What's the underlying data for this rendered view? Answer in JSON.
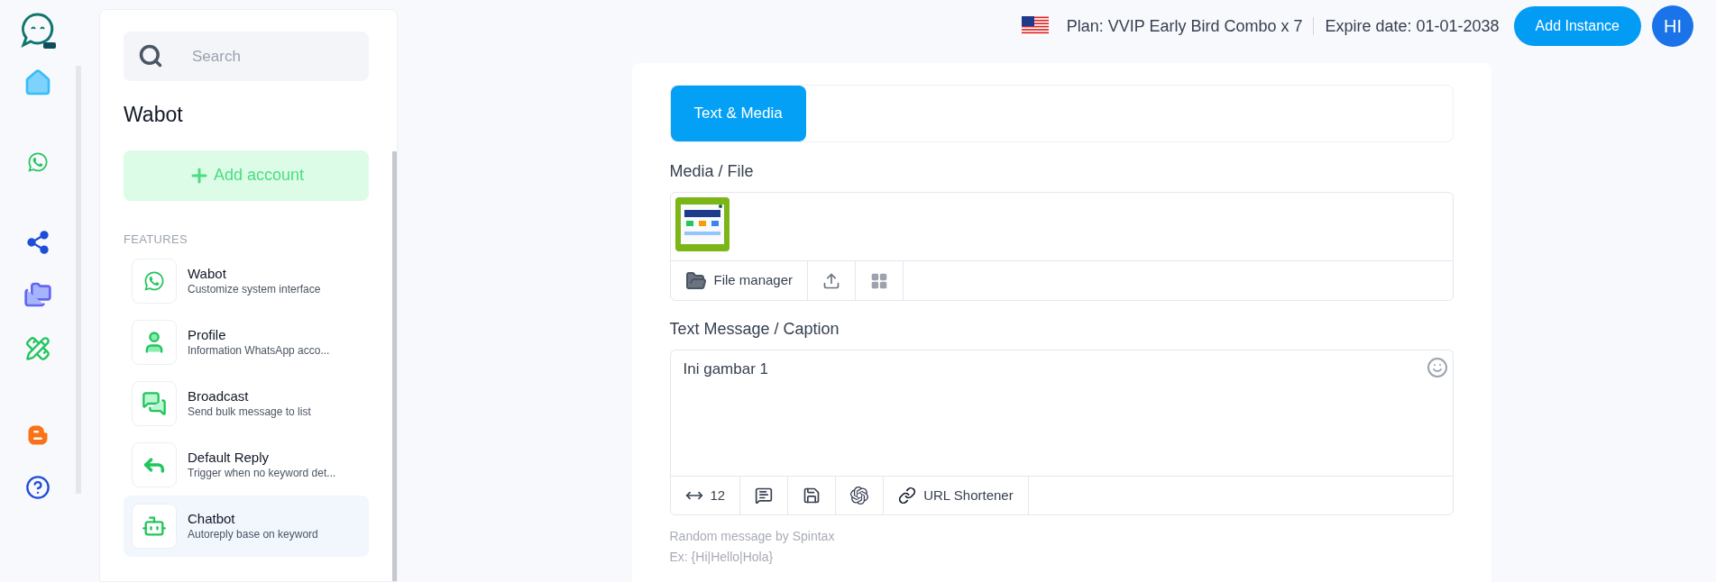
{
  "top_bar": {
    "plan": "Plan: VVIP Early Bird Combo x 7",
    "expire": "Expire date: 01-01-2038",
    "add_button": "Add Instance",
    "avatar": "HI"
  },
  "sidebar": {
    "search_placeholder": "Search",
    "title": "Wabot",
    "add_button": "Add account",
    "section": "FEATURES",
    "items": [
      {
        "kind": "whatsapp",
        "title": "Wabot",
        "subtitle": "Customize system interface",
        "selected": false
      },
      {
        "kind": "profile",
        "title": "Profile",
        "subtitle": "Information WhatsApp acco...",
        "selected": false
      },
      {
        "kind": "broadcast",
        "title": "Broadcast",
        "subtitle": "Send bulk message to list",
        "selected": false
      },
      {
        "kind": "reply",
        "title": "Default Reply",
        "subtitle": "Trigger when no keyword det...",
        "selected": false
      },
      {
        "kind": "bot",
        "title": "Chatbot",
        "subtitle": "Autoreply base on keyword",
        "selected": true
      }
    ]
  },
  "editor": {
    "tabs": [
      {
        "label": "Text & Media",
        "selected": true
      }
    ],
    "media_label": "Media / File",
    "media_toolbar": [
      {
        "kind": "folder",
        "label": "File manager"
      },
      {
        "kind": "upload"
      },
      {
        "kind": "grid"
      }
    ],
    "caption_label": "Text Message / Caption",
    "caption_value": "Ini gambar 1",
    "caption_toolbar": [
      {
        "kind": "spacing",
        "label": "12"
      },
      {
        "kind": "comment"
      },
      {
        "kind": "save"
      },
      {
        "kind": "ai"
      },
      {
        "kind": "link",
        "label": "URL Shortener"
      }
    ],
    "hints": [
      "Random message by Spintax",
      "Ex: {Hi|Hello|Hola}"
    ]
  }
}
